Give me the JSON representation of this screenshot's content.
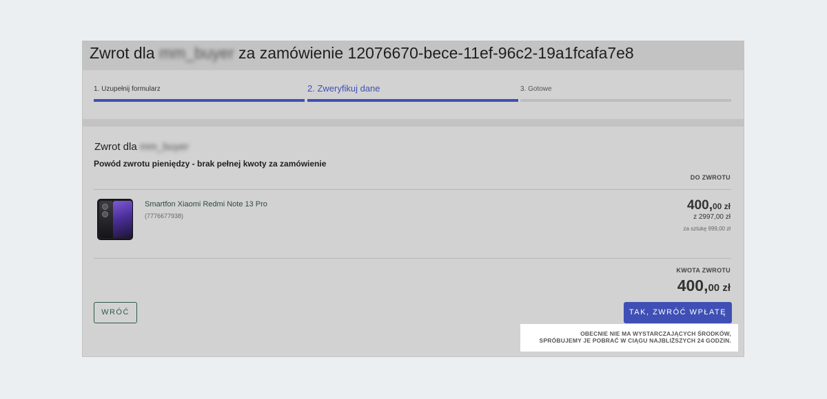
{
  "header": {
    "title_prefix": "Zwrot dla",
    "buyer_name": "mm_buyer",
    "title_suffix": "za zamówienie 12076670-bece-11ef-96c2-19a1fcafa7e8"
  },
  "steps": [
    {
      "label": "1. Uzupełnij formularz",
      "state": "done"
    },
    {
      "label": "2. Zweryfikuj dane",
      "state": "active"
    },
    {
      "label": "3. Gotowe",
      "state": "pending"
    }
  ],
  "section": {
    "title_prefix": "Zwrot dla",
    "buyer_name": "mm_buyer",
    "reason": "Powód zwrotu pieniędzy - brak pełnej kwoty za zamówienie",
    "column_header": "DO ZWROTU"
  },
  "product": {
    "image_icon": "phone-product-image",
    "name": "Smartfon Xiaomi Redmi Note 13 Pro",
    "id": "(7776677938)",
    "amount_main": "400,",
    "amount_cents": "00 zł",
    "of_total": "z 2997,00 zł",
    "per_unit": "za sztukę 999,00 zł"
  },
  "refund": {
    "label": "KWOTA ZWROTU",
    "amount_main": "400,",
    "amount_cents": "00 zł"
  },
  "buttons": {
    "back": "WRÓĆ",
    "confirm": "TAK, ZWRÓĆ WPŁATĘ"
  },
  "notice": {
    "line1": "OBECNIE NIE MA WYSTARCZAJĄCYCH ŚRODKÓW,",
    "line2": "SPRÓBUJEMY JE POBRAĆ W CIĄGU NAJBLIŻSZYCH 24 GODZIN."
  },
  "colors": {
    "accent": "#3f4fb5",
    "back_button": "#2d5a46",
    "panel": "#d2d2d2",
    "background": "#eceff2"
  }
}
